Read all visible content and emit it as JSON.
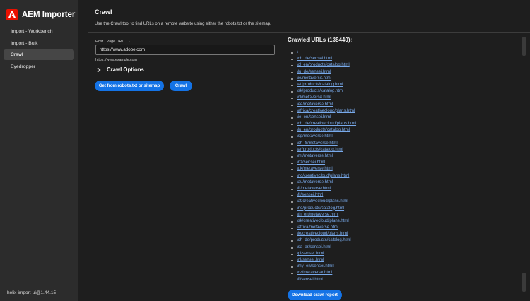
{
  "app": {
    "title": "AEM Importer",
    "version": "helix-import-ui@1.44.15"
  },
  "sidebar": {
    "items": [
      {
        "label": "Import - Workbench"
      },
      {
        "label": "Import - Bulk"
      },
      {
        "label": "Crawl",
        "active": true
      },
      {
        "label": "Eyedropper"
      }
    ]
  },
  "page": {
    "title": "Crawl",
    "description": "Use the Crawl tool to find URLs on a remote website using either the robots.txt or the sitemap."
  },
  "form": {
    "host_label": "Host / Page URL",
    "host_value": "https://www.adobe.com",
    "host_help": "https://www.example.com",
    "crawl_options_label": "Crawl Options",
    "robots_button": "Get from robots.txt or sitemap",
    "crawl_button": "Crawl"
  },
  "results": {
    "title": "Crawled URLs (138440):",
    "urls": [
      "/",
      "/ch_de/sensei.html",
      "/cl_en/products/catalog.html",
      "/lu_de/sensei.html",
      "/ie/metaverse.html",
      "/at/products/catalog.html",
      "/sk/products/catalog.html",
      "/cl/metaverse.html",
      "/ee/metaverse.html",
      "/africa/creativecloud/plans.html",
      "/ie_en/sensei.html",
      "/ch_de/creativecloud/plans.html",
      "/lu_en/products/catalog.html",
      "/sg/metaverse.html",
      "/ch_fr/metaverse.html",
      "/ar/products/catalog.html",
      "/mt/metaverse.html",
      "/nz/sensei.html",
      "/uk/metaverse.html",
      "/no/creativecloud/plans.html",
      "/au/metaverse.html",
      "/fr/metaverse.html",
      "/fr/sensei.html",
      "/at/creativecloud/plans.html",
      "/no/products/catalog.html",
      "/th_en/metaverse.html",
      "/sk/creativecloud/plans.html",
      "/africa/metaverse.html",
      "/ie/creativecloud/plans.html",
      "/ch_de/products/catalog.html",
      "/sa_ar/sensei.html",
      "/pl/sensei.html",
      "/nl/sensei.html",
      "/my_en/sensei.html",
      "/cz/metaverse.html",
      "/fi/sensei.html"
    ],
    "download_button": "Download crawl report"
  }
}
